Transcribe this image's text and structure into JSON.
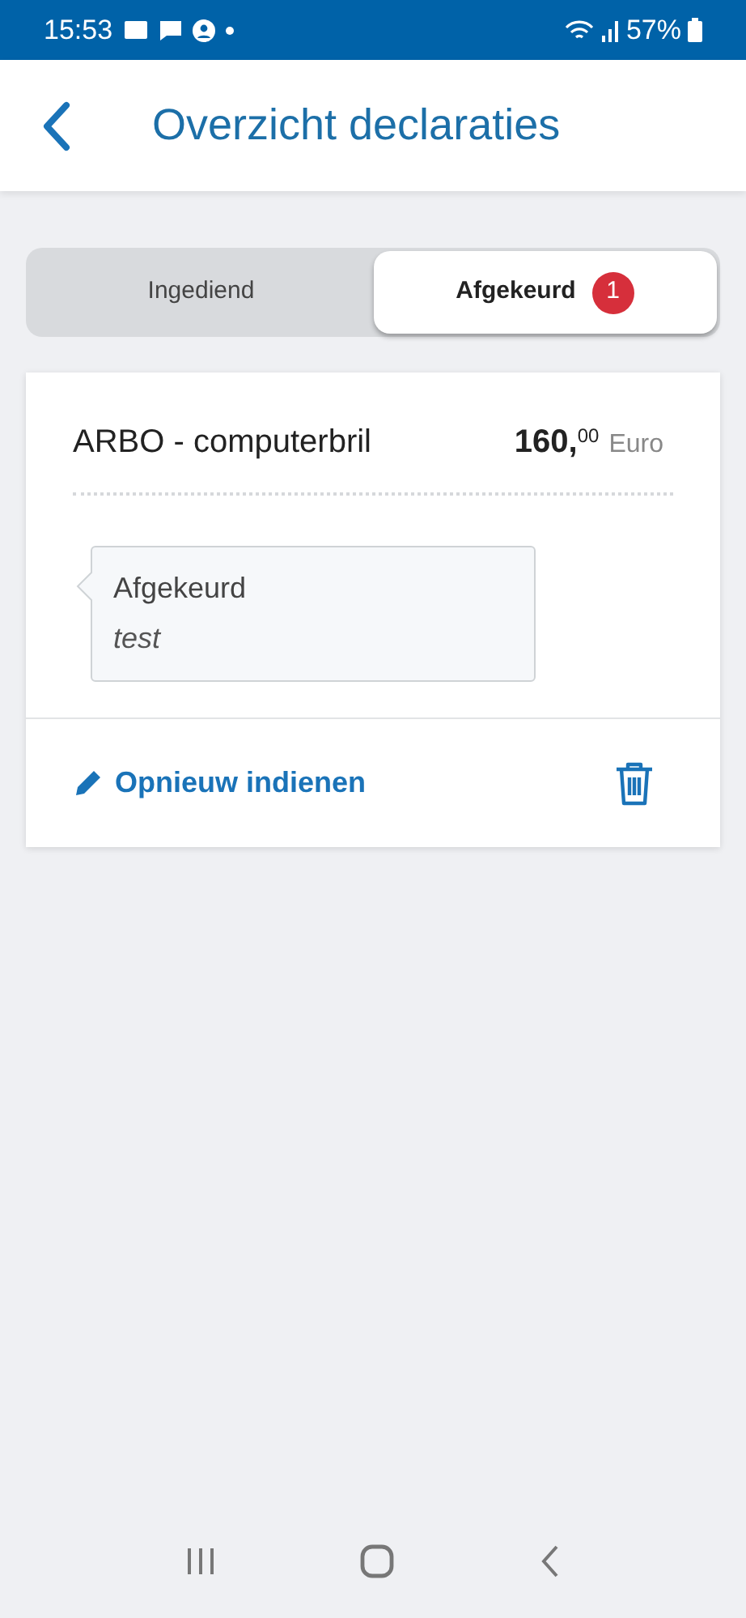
{
  "status_bar": {
    "time": "15:53",
    "battery": "57%"
  },
  "header": {
    "title": "Overzicht declaraties"
  },
  "tabs": [
    {
      "label": "Ingediend",
      "selected": false
    },
    {
      "label": "Afgekeurd",
      "selected": true,
      "badge": "1"
    }
  ],
  "claims": [
    {
      "title": "ARBO - computerbril",
      "amount": "160,$^{00}$",
      "currency": "Euro",
      "status": {
        "label": "Afgekeurd",
        "note": "test"
      },
      "action": "Opnieuw indienen"
    }
  ]
}
